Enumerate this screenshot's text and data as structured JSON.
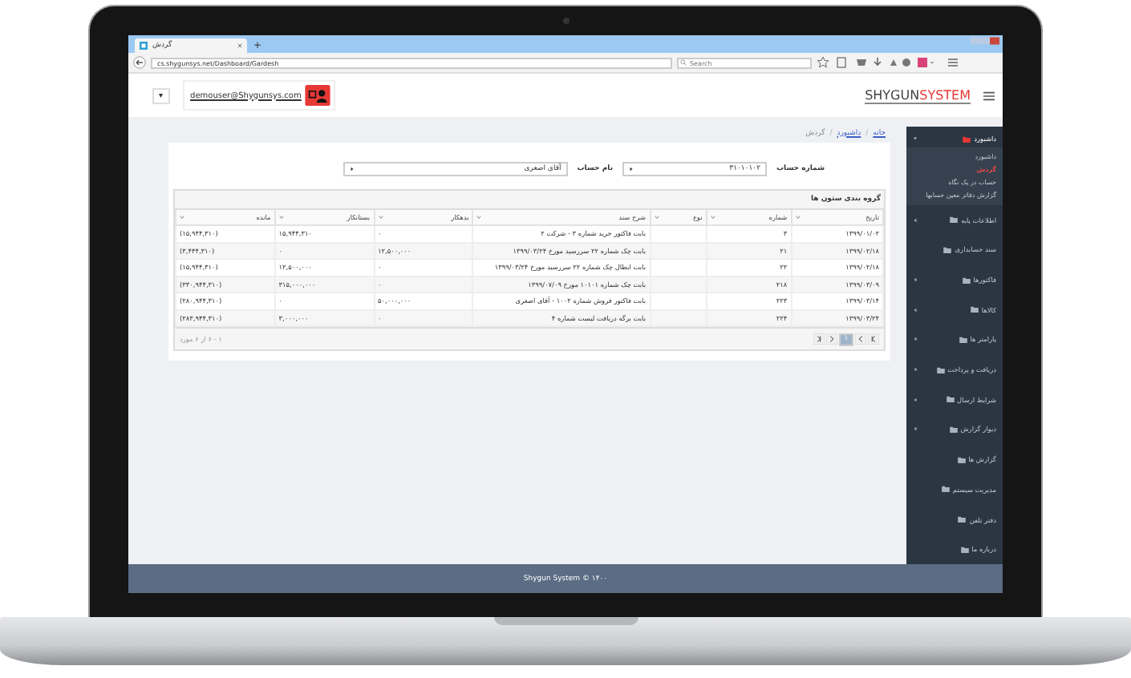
{
  "browser": {
    "tab_title": "گردش",
    "new_tab": "+",
    "url": "cs.shygunsys.net/Dashboard/Gardesh",
    "search": {
      "placeholder": "Search"
    }
  },
  "header": {
    "dropdown": "▾",
    "user_email": "demouser@Shygunsys.com",
    "logo": {
      "first": "SHYGUN",
      "second": "SYSTEM"
    }
  },
  "breadcrumb": [
    {
      "label": "خانه",
      "link": true
    },
    {
      "separator": "/",
      "label": "داشبورد",
      "link": true
    },
    {
      "separator": "/",
      "label": "گردش",
      "link": false
    }
  ],
  "filters": [
    {
      "label": "شماره حساب",
      "value": "۳۱۰۱۰۱۰۲"
    },
    {
      "label": "نام حساب",
      "value": "آقای اصغری"
    }
  ],
  "table": {
    "group_hint": "گروه بندی ستون ها",
    "columns": [
      "تاریخ",
      "شماره",
      "نوع",
      "شرح سند",
      "بدهکار",
      "بستانکار",
      "مانده"
    ],
    "rows": [
      [
        "۱۳۹۹/۰۱/۰۲",
        "۳",
        "",
        "بابت فاکتور خرید شماره ۳ - شرکت ۲",
        "۰",
        "۱۵,۹۴۴,۳۱۰",
        "(۱۵,۹۴۴,۳۱۰)"
      ],
      [
        "۱۳۹۹/۰۲/۱۸",
        "۲۱",
        "",
        "بابت چک شماره ۲۲ سررسید مورخ ۱۳۹۹/۰۳/۲۴",
        "۱۲,۵۰۰,۰۰۰",
        "۰",
        "(۳,۴۴۴,۳۱۰)"
      ],
      [
        "۱۳۹۹/۰۲/۱۸",
        "۲۲",
        "",
        "بابت ابطال چک شماره ۲۲ سررسید مورخ ۱۳۹۹/۰۳/۲۴",
        "۰",
        "۱۲,۵۰۰,۰۰۰",
        "(۱۵,۹۴۴,۳۱۰)"
      ],
      [
        "۱۳۹۹/۰۳/۰۹",
        "۲۱۸",
        "",
        "بابت چک شماره ۱۰۱۰۱ مورخ ۱۳۹۹/۰۷/۰۹",
        "۰",
        "۳۱۵,۰۰۰,۰۰۰",
        "(۳۳۰,۹۴۴,۳۱۰)"
      ],
      [
        "۱۳۹۹/۰۳/۱۴",
        "۲۲۳",
        "",
        "بابت فاکتور فروش شماره ۱۰۰۲ - آقای اصغری",
        "۵۰,۰۰۰,۰۰۰",
        "۰",
        "(۲۸۰,۹۴۴,۳۱۰)"
      ],
      [
        "۱۳۹۹/۰۳/۲۴",
        "۲۲۴",
        "",
        "بابت برگه دریافت لیست شماره ۴",
        "۰",
        "۳,۰۰۰,۰۰۰",
        "(۲۸۳,۹۴۴,۳۱۰)"
      ]
    ]
  },
  "pager": {
    "pages": [
      {
        "label": "۱",
        "selected": true
      }
    ],
    "summary": "۱ - ۶ از ۶ مورد"
  },
  "sidebar": {
    "items": [
      {
        "label": "داشبورد",
        "expandable": true,
        "expanded": true,
        "children": [
          {
            "label": "داشبورد",
            "selected": false
          },
          {
            "label": "گردش",
            "selected": true
          },
          {
            "label": "حساب در یک نگاه",
            "selected": false
          },
          {
            "label": "گزارش دفاتر معین حسابها",
            "selected": false
          }
        ]
      },
      {
        "label": "اطلاعات پایه",
        "expandable": true,
        "expanded": false
      },
      {
        "label": "سند حسابداری",
        "expandable": false,
        "expanded": false
      },
      {
        "label": "فاکتورها",
        "expandable": true,
        "expanded": false
      },
      {
        "label": "کالاها",
        "expandable": true,
        "expanded": false
      },
      {
        "label": "پارامتر ها",
        "expandable": true,
        "expanded": false
      },
      {
        "label": "دریافت و پرداخت",
        "expandable": true,
        "expanded": false
      },
      {
        "label": "شرایط ارسال",
        "expandable": true,
        "expanded": false
      },
      {
        "label": "دیوار گزارش",
        "expandable": true,
        "expanded": false
      },
      {
        "label": "گزارش ها",
        "expandable": false,
        "expanded": false
      },
      {
        "label": "مدیریت سیستم",
        "expandable": false,
        "expanded": false
      },
      {
        "label": "دفتر تلفن",
        "expandable": false,
        "expanded": false
      },
      {
        "label": "درباره ما",
        "expandable": false,
        "expanded": false
      }
    ]
  },
  "footer": "Shygun System © ۱۴۰۰"
}
